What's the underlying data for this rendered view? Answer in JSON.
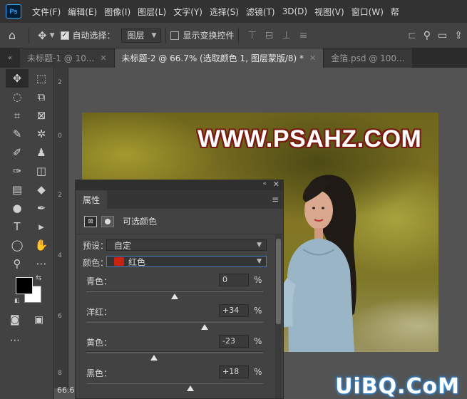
{
  "app": {
    "logo_text": "Ps"
  },
  "menu": [
    "文件(F)",
    "编辑(E)",
    "图像(I)",
    "图层(L)",
    "文字(Y)",
    "选择(S)",
    "滤镜(T)",
    "3D(D)",
    "视图(V)",
    "窗口(W)",
    "帮"
  ],
  "options": {
    "auto_select_label": "自动选择：",
    "auto_select_checked": true,
    "auto_select_target": "图层",
    "show_transform_label": "显示变换控件",
    "show_transform_checked": false
  },
  "tabs": [
    {
      "label": "未标题-1 @ 10...",
      "active": false
    },
    {
      "label": "未标题-2 @ 66.7% (选取颜色 1, 图层蒙版/8) *",
      "active": true
    },
    {
      "label": "金箔.psd @ 100...",
      "active": false
    }
  ],
  "tools": [
    "move-icon",
    "marquee-icon",
    "lasso-icon",
    "object-select-icon",
    "crop-icon",
    "frame-icon",
    "eyedropper-icon",
    "patch-icon",
    "brush-icon",
    "stamp-icon",
    "history-brush-icon",
    "eraser-icon",
    "gradient-icon",
    "blur-icon",
    "dodge-icon",
    "pen-icon",
    "type-icon",
    "path-select-icon",
    "ellipse-icon",
    "hand-icon",
    "zoom-icon",
    "more-icon"
  ],
  "tool_glyphs": [
    "✥",
    "⬚",
    "◌",
    "⧉",
    "⌗",
    "⊠",
    "✎",
    "✲",
    "✐",
    "♟",
    "✑",
    "◫",
    "▤",
    "◆",
    "●",
    "✒",
    "T",
    "▸",
    "◯",
    "✋",
    "⚲",
    "⋯"
  ],
  "colors": {
    "foreground": "#000000",
    "background": "#ffffff"
  },
  "ruler": {
    "numbers": [
      "2",
      "0",
      "2",
      "4",
      "6",
      "8"
    ]
  },
  "canvas": {
    "watermark": "WWW.PSAHZ.COM"
  },
  "zoom_display": "66.6",
  "properties": {
    "tab_label": "属性",
    "adjustment_name": "可选颜色",
    "preset_label": "预设：",
    "preset_value": "自定",
    "color_label": "颜色：",
    "color_value": "红色",
    "color_swatch": "#c9230f",
    "sliders": [
      {
        "label": "青色：",
        "value": "0",
        "unit": "%",
        "position": 0.5
      },
      {
        "label": "洋红：",
        "value": "+34",
        "unit": "%",
        "position": 0.67
      },
      {
        "label": "黄色：",
        "value": "-23",
        "unit": "%",
        "position": 0.385
      },
      {
        "label": "黑色：",
        "value": "+18",
        "unit": "%",
        "position": 0.59
      }
    ]
  },
  "brand": "UiBQ.CoM"
}
